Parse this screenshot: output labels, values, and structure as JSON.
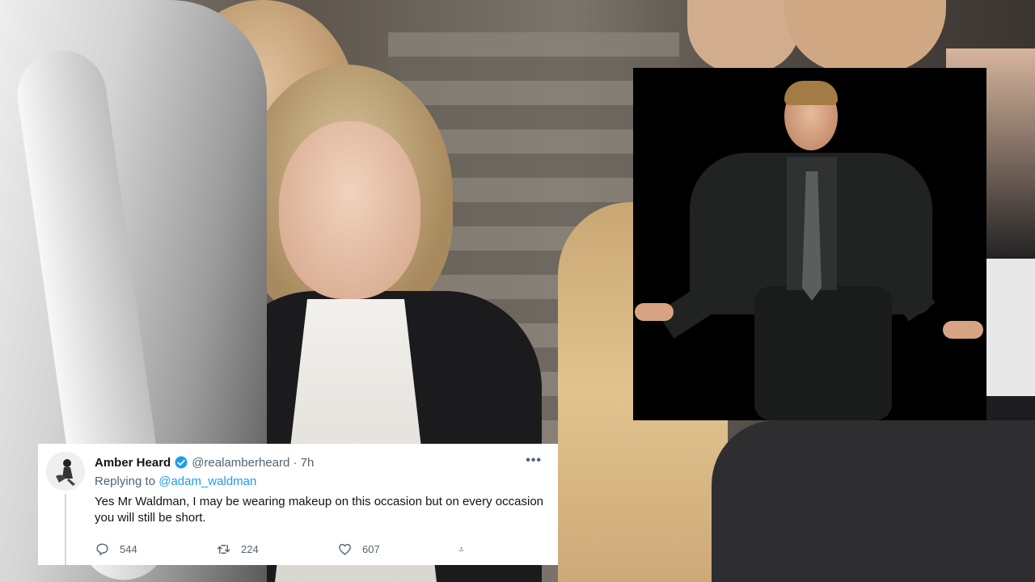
{
  "tweet": {
    "display_name": "Amber Heard",
    "handle_time": "@realamberheard · 7h",
    "more_label": "•••",
    "replying_prefix": "Replying to",
    "replying_to": "@adam_waldman",
    "text": "Yes Mr Waldman, I may be wearing makeup on this occasion but on every occasion you will still be short.",
    "replies": "544",
    "retweets": "224",
    "likes": "607"
  },
  "icons": {
    "verified": "verified-badge-icon",
    "reply": "reply-icon",
    "retweet": "retweet-icon",
    "like": "heart-icon",
    "share": "share-icon",
    "more": "more-options-icon"
  },
  "colors": {
    "accent": "#1d9bf0",
    "text_primary": "#0f1419",
    "text_secondary": "#536471"
  }
}
